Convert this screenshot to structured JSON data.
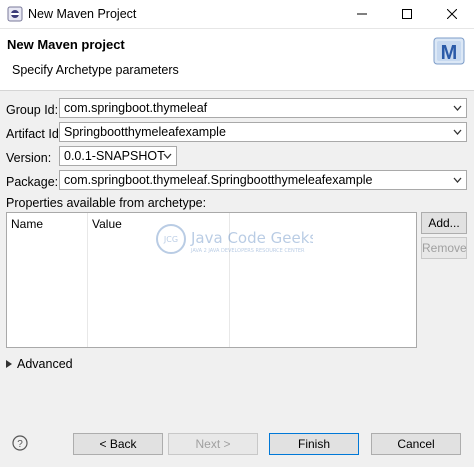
{
  "window": {
    "title": "New Maven Project"
  },
  "header": {
    "title": "New Maven project",
    "description": "Specify Archetype parameters",
    "logo_letter": "M"
  },
  "form": {
    "group_id_label": "Group Id:",
    "group_id_value": "com.springboot.thymeleaf",
    "artifact_id_label": "Artifact Id:",
    "artifact_id_value": "Springbootthymeleafexample",
    "version_label": "Version:",
    "version_value": "0.0.1-SNAPSHOT",
    "package_label": "Package:",
    "package_value": "com.springboot.thymeleaf.Springbootthymeleafexample"
  },
  "properties": {
    "label": "Properties available from archetype:",
    "columns": [
      "Name",
      "Value"
    ],
    "add_label": "Add...",
    "remove_label": "Remove"
  },
  "watermark": {
    "text": "Java Code Geeks",
    "subtext": "JAVA 2 JAVA DEVELOPERS RESOURCE CENTER",
    "badge": "JCG"
  },
  "advanced": {
    "label": "Advanced"
  },
  "footer": {
    "back_label": "< Back",
    "next_label": "Next >",
    "finish_label": "Finish",
    "cancel_label": "Cancel"
  },
  "colors": {
    "accent": "#0078d7",
    "maven_blue": "#2a5aa8"
  }
}
